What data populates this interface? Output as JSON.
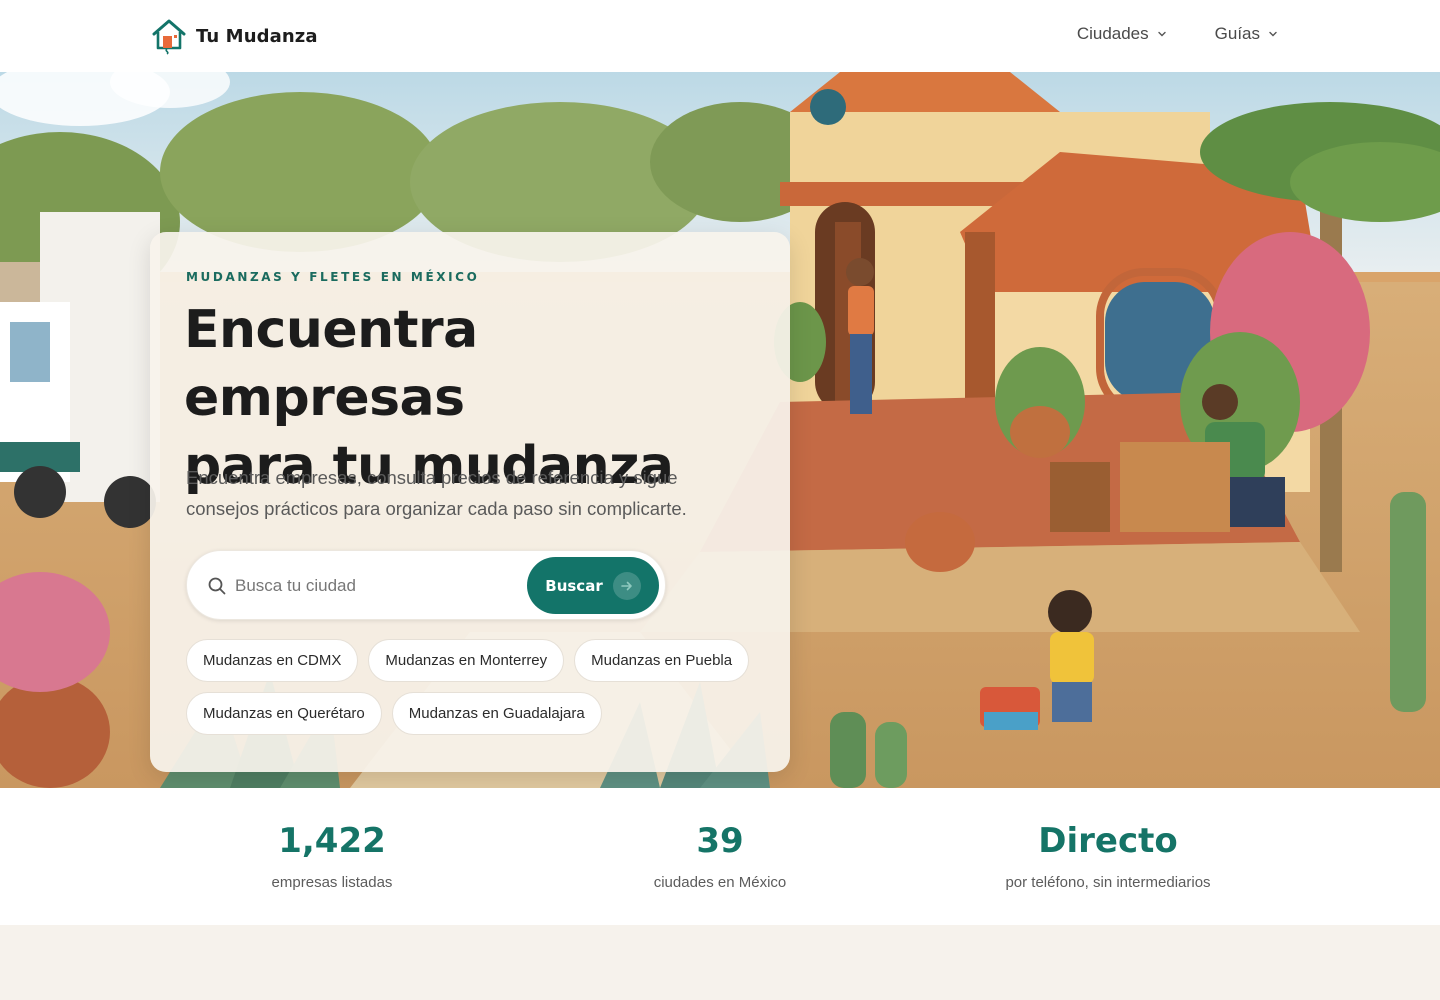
{
  "brand": {
    "name": "Tu Mudanza",
    "logo_icon": "house-logo-icon"
  },
  "nav": {
    "items": [
      {
        "label": "Ciudades",
        "icon": "chevron-down-icon"
      },
      {
        "label": "Guías",
        "icon": "chevron-down-icon"
      }
    ]
  },
  "hero": {
    "eyebrow": "MUDANZAS Y FLETES EN MÉXICO",
    "headline_line1": "Encuentra empresas",
    "headline_line2": "para tu mudanza",
    "subtitle": "Encuentra empresas, consulta precios de referencia y sigue consejos prácticos para organizar cada paso sin complicarte.",
    "search": {
      "placeholder": "Busca tu ciudad",
      "value": "",
      "button_label": "Buscar",
      "icon": "search-icon",
      "button_icon": "arrow-right-icon"
    },
    "chips": [
      "Mudanzas en CDMX",
      "Mudanzas en Monterrey",
      "Mudanzas en Puebla",
      "Mudanzas en Querétaro",
      "Mudanzas en Guadalajara"
    ]
  },
  "stats": [
    {
      "value": "1,422",
      "label": "empresas listadas"
    },
    {
      "value": "39",
      "label": "ciudades en México"
    },
    {
      "value": "Directo",
      "label": "por teléfono, sin intermediarios"
    }
  ],
  "colors": {
    "accent": "#137469",
    "stat_value": "#157467",
    "eyebrow": "#1a6b5f",
    "page_bg": "#f6f2ec"
  }
}
